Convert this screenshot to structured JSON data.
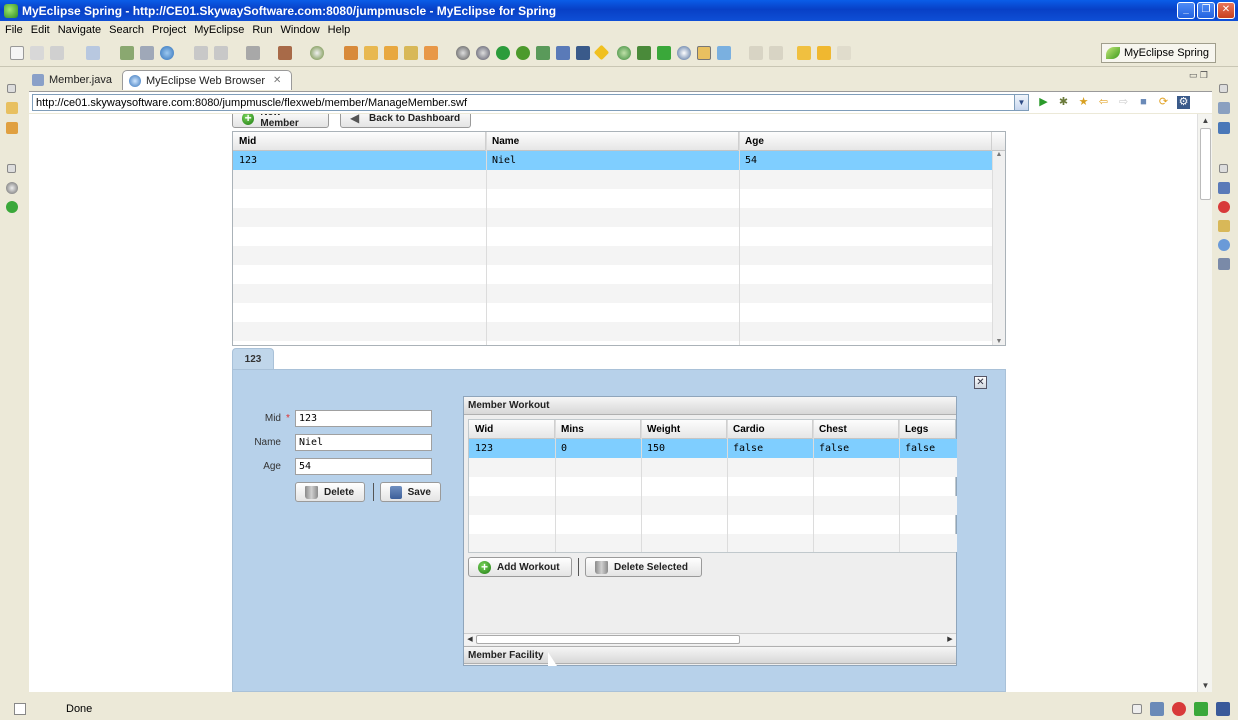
{
  "window": {
    "title": "MyEclipse Spring - http://CE01.SkywaySoftware.com:8080/jumpmuscle - MyEclipse for Spring",
    "minimize": "_",
    "maximize": "❐",
    "close": "✕"
  },
  "menu": [
    "File",
    "Edit",
    "Navigate",
    "Search",
    "Project",
    "MyEclipse",
    "Run",
    "Window",
    "Help"
  ],
  "perspective": {
    "label": "MyEclipse Spring"
  },
  "editor_tabs": [
    {
      "label": "Member.java",
      "icon": "java-file-icon"
    },
    {
      "label": "MyEclipse Web Browser",
      "icon": "globe-icon",
      "close": "✕"
    }
  ],
  "address": {
    "url": "http://ce01.skywaysoftware.com:8080/jumpmuscle/flexweb/member/ManageMember.swf"
  },
  "app": {
    "buttons": {
      "new_member": "New Member",
      "back_to_dashboard": "Back to Dashboard"
    },
    "member_grid": {
      "columns": [
        "Mid",
        "Name",
        "Age"
      ],
      "rows": [
        {
          "mid": "123",
          "name": "Niel",
          "age": "54"
        }
      ]
    },
    "detail_tab": "123",
    "form": {
      "mid_label": "Mid",
      "mid_value": "123",
      "required_mark": "*",
      "name_label": "Name",
      "name_value": "Niel",
      "age_label": "Age",
      "age_value": "54",
      "delete_label": "Delete",
      "save_label": "Save"
    },
    "close_glyph": "✕",
    "workout": {
      "header": "Member Workout",
      "columns": [
        "Wid",
        "Mins",
        "Weight",
        "Cardio",
        "Chest",
        "Legs"
      ],
      "rows": [
        {
          "wid": "123",
          "mins": "0",
          "weight": "150",
          "cardio": "false",
          "chest": "false",
          "legs": "false"
        }
      ],
      "add_label": "Add Workout",
      "delete_selected_label": "Delete Selected"
    },
    "facility_header": "Member Facility"
  },
  "status": {
    "text": "Done"
  }
}
